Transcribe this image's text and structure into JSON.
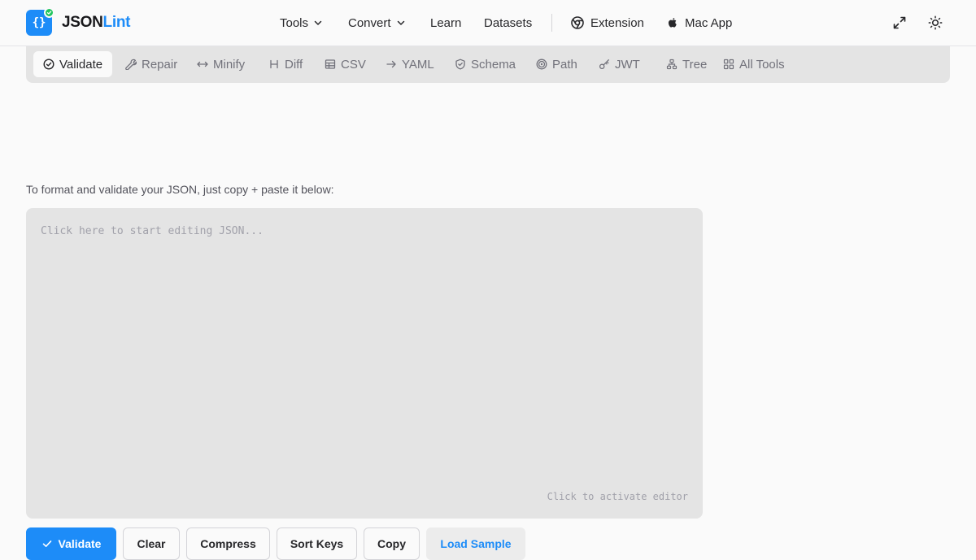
{
  "header": {
    "logo_glyph": "{}",
    "brand_part1": "JSON",
    "brand_part2": "Lint",
    "nav": {
      "tools": "Tools",
      "convert": "Convert",
      "learn": "Learn",
      "datasets": "Datasets",
      "extension": "Extension",
      "mac_app": "Mac App"
    },
    "icons": [
      "expand-icon",
      "sun-icon"
    ]
  },
  "toolbar": {
    "items": [
      {
        "label": "Validate",
        "icon": "check-circle-icon",
        "active": true
      },
      {
        "label": "Repair",
        "icon": "wrench-icon"
      },
      {
        "label": "Minify",
        "icon": "arrows-horizontal-icon"
      },
      {
        "label": "Diff",
        "icon": "diff-icon"
      },
      {
        "label": "CSV",
        "icon": "table-icon"
      },
      {
        "label": "YAML",
        "icon": "arrow-right-icon"
      },
      {
        "label": "Schema",
        "icon": "shield-check-icon"
      },
      {
        "label": "Path",
        "icon": "target-icon"
      },
      {
        "label": "JWT",
        "icon": "key-icon"
      },
      {
        "label": "Tree",
        "icon": "tree-icon"
      },
      {
        "label": "All Tools",
        "icon": "grid-icon"
      }
    ]
  },
  "main": {
    "intro": "To format and validate your JSON, just copy + paste it below:",
    "editor_placeholder": "Click here to start editing JSON...",
    "editor_hint": "Click to activate editor"
  },
  "actions": {
    "validate": "Validate",
    "clear": "Clear",
    "compress": "Compress",
    "sort_keys": "Sort Keys",
    "copy": "Copy",
    "load_sample": "Load Sample"
  },
  "colors": {
    "accent": "#1d8cf8",
    "success": "#22c55e",
    "panel": "#e4e4e4",
    "background": "#fafafa"
  }
}
